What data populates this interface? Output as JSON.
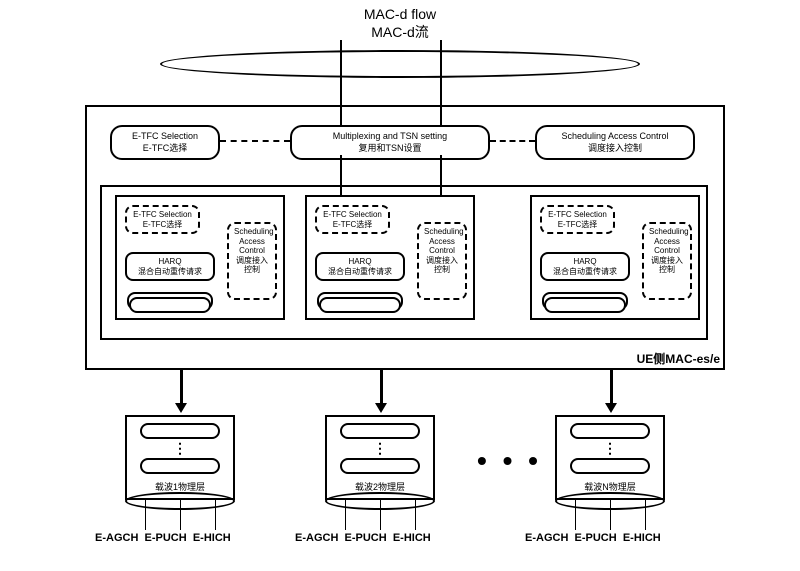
{
  "title": {
    "line1": "MAC-d flow",
    "line2": "MAC-d流"
  },
  "top_boxes": {
    "etfc": {
      "en": "E-TFC Selection",
      "zh": "E-TFC选择"
    },
    "mux": {
      "en": "Multiplexing and TSN setting",
      "zh": "复用和TSN设置"
    },
    "sched": {
      "en": "Scheduling Access Control",
      "zh": "调度接入控制"
    }
  },
  "carrier": {
    "etfc": {
      "en": "E-TFC Selection",
      "zh": "E-TFC选择"
    },
    "sched": {
      "en": "Scheduling Access Control",
      "zh": "调度接入控制"
    },
    "harq": {
      "en": "HARQ",
      "zh": "混合自动重传请求"
    }
  },
  "ue_label": "UE侧MAC-es/e",
  "phy": {
    "carrier1": "载波1物理层",
    "carrier2": "载波2物理层",
    "carrierN": "载波N物理层"
  },
  "channels": {
    "agch": "E-AGCH",
    "puch": "E-PUCH",
    "hich": "E-HICH"
  },
  "dots": "• • •",
  "phy_dots": "⋮"
}
